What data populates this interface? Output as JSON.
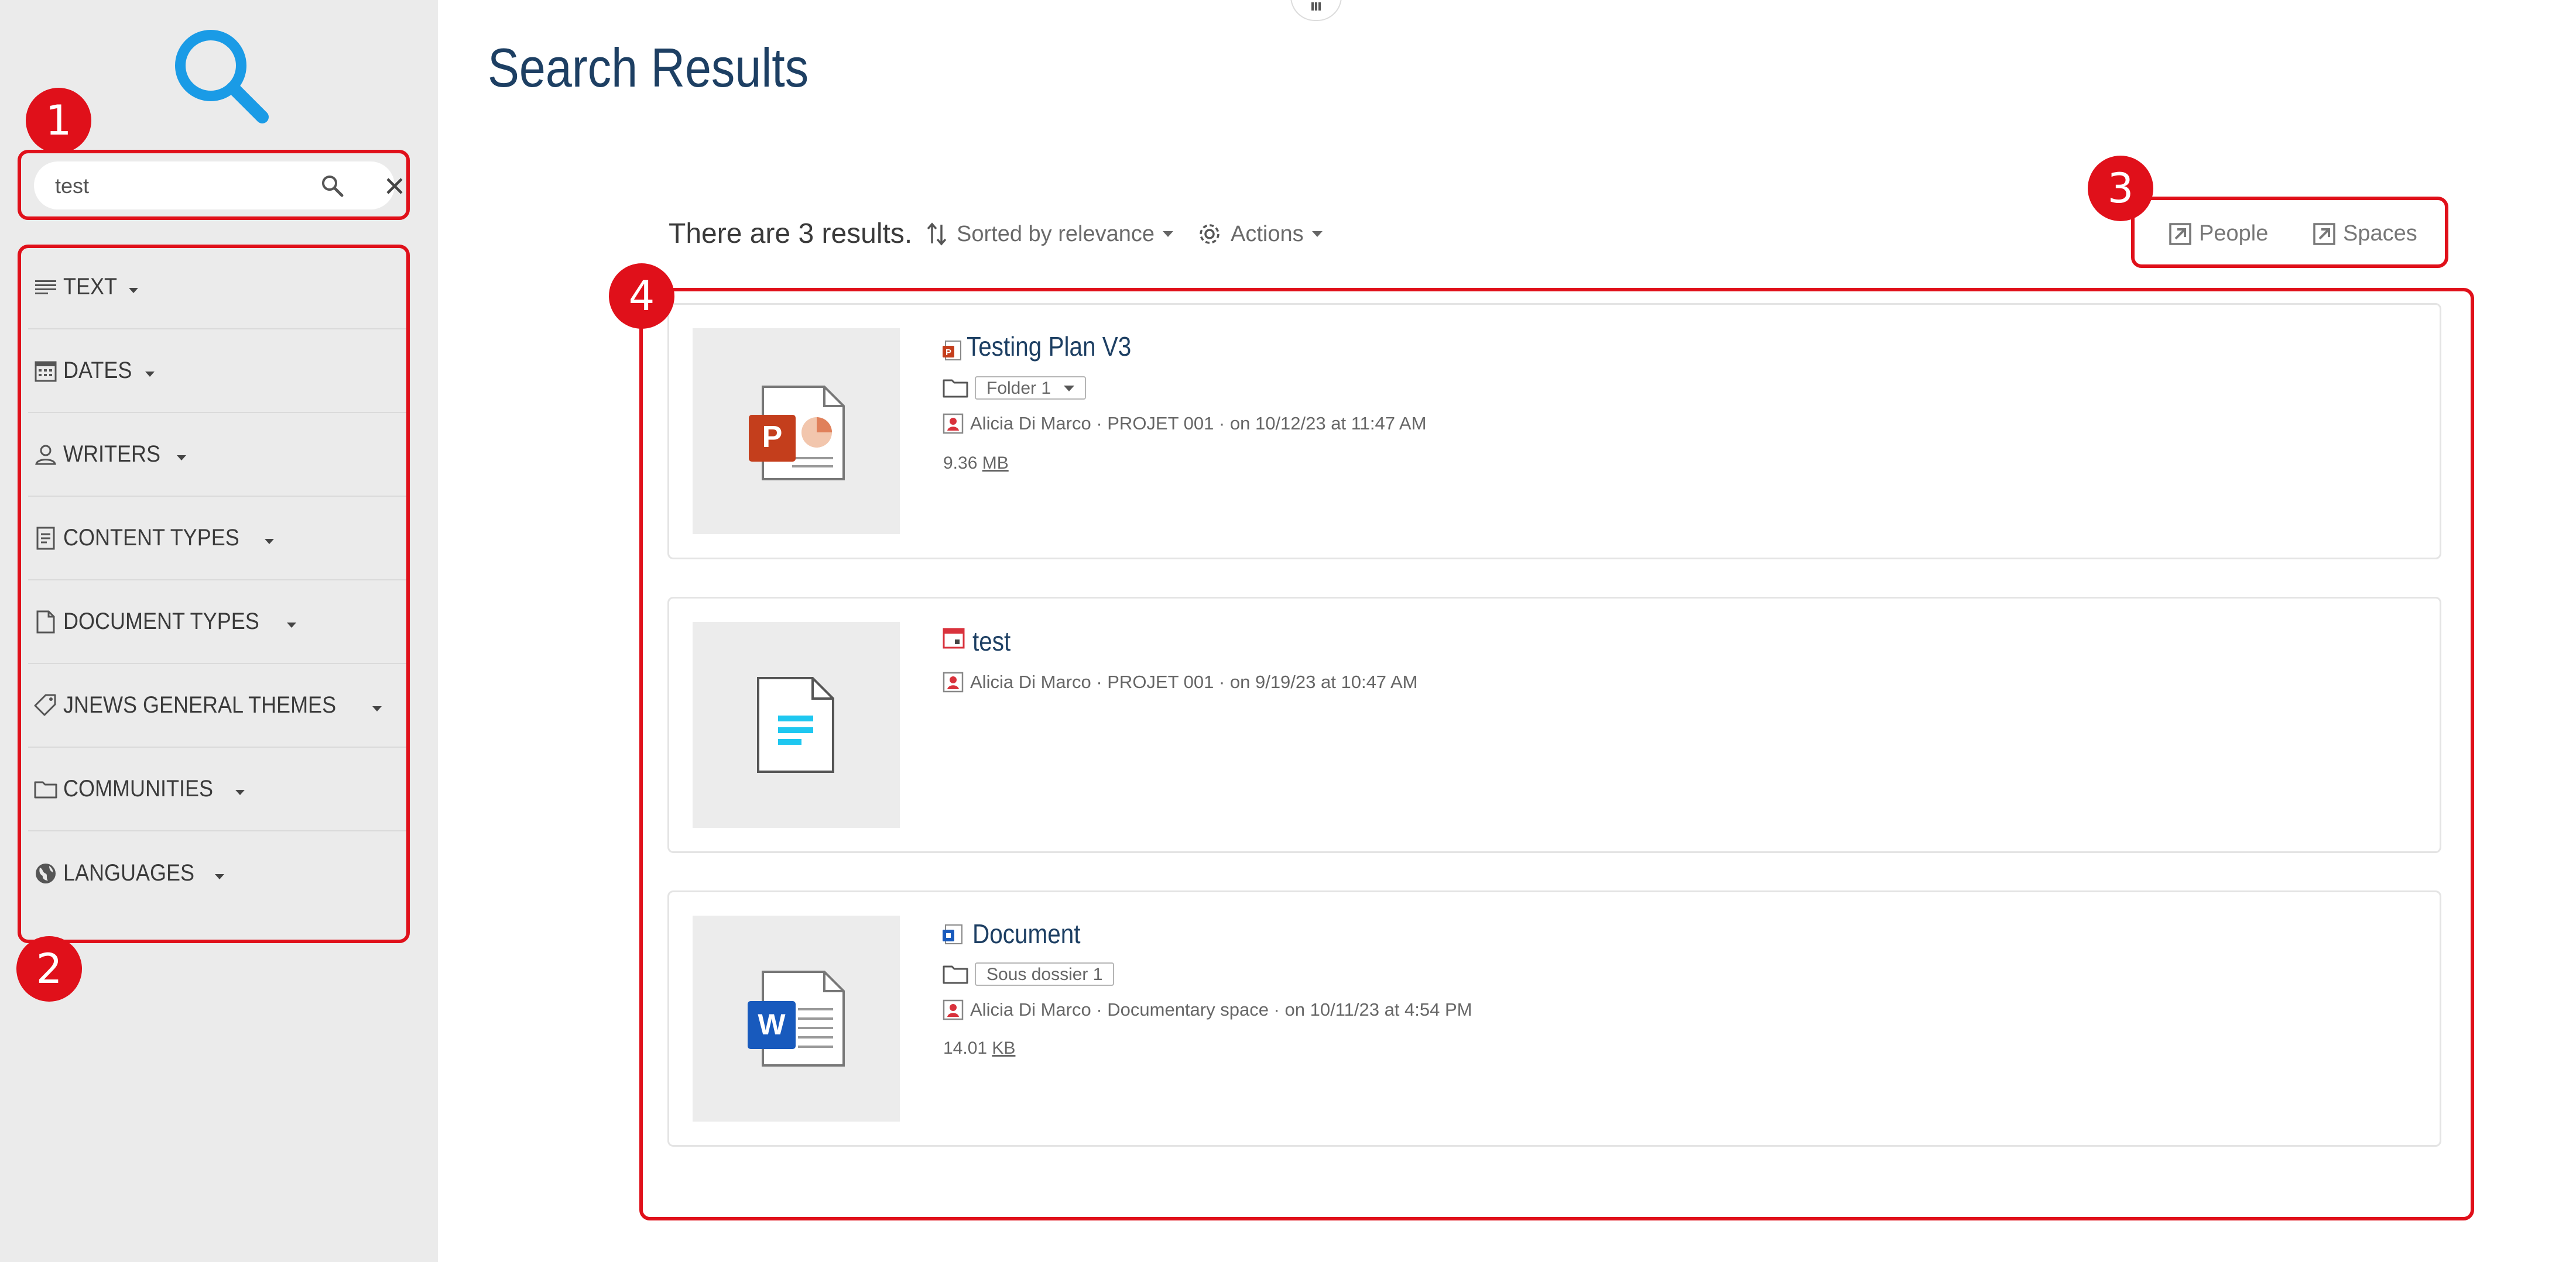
{
  "sidebar": {
    "search": {
      "value": "test",
      "placeholder": ""
    },
    "facets": [
      {
        "label": "TEXT",
        "icon": "text-lines-icon"
      },
      {
        "label": "DATES",
        "icon": "calendar-icon"
      },
      {
        "label": "WRITERS",
        "icon": "user-icon"
      },
      {
        "label": "CONTENT TYPES",
        "icon": "document-lines-icon"
      },
      {
        "label": "DOCUMENT TYPES",
        "icon": "document-icon"
      },
      {
        "label": "JNEWS GENERAL THEMES",
        "icon": "tag-icon"
      },
      {
        "label": "COMMUNITIES",
        "icon": "folder-icon"
      },
      {
        "label": "LANGUAGES",
        "icon": "globe-icon"
      }
    ]
  },
  "main": {
    "title": "Search Results",
    "results_count": "There are 3 results.",
    "sort_label": "Sorted by relevance",
    "actions_label": "Actions",
    "scope_links": {
      "people": "People",
      "spaces": "Spaces"
    },
    "results": [
      {
        "title": "Testing Plan V3",
        "type_icon": "powerpoint-icon",
        "folder": "Folder 1",
        "meta": "Alicia Di Marco · PROJET 001 · on 10/12/23 at 11:47 AM",
        "size_value": "9.36",
        "size_unit": "MB"
      },
      {
        "title": "test",
        "type_icon": "calendar-event-icon",
        "meta": "Alicia Di Marco · PROJET 001 · on 9/19/23 at 10:47 AM"
      },
      {
        "title": "Document",
        "type_icon": "word-icon",
        "folder": "Sous dossier 1",
        "meta": "Alicia Di Marco · Documentary space · on 10/11/23 at 4:54 PM",
        "size_value": "14.01",
        "size_unit": "KB"
      }
    ]
  },
  "annotations": [
    "1",
    "2",
    "3",
    "4"
  ],
  "colors": {
    "accent_blue": "#1a9be6",
    "title_navy": "#1d3f63",
    "annotation_red": "#e0101a",
    "sidebar_bg": "#ebebeb",
    "powerpoint": "#c43e1c",
    "word": "#185abd"
  }
}
